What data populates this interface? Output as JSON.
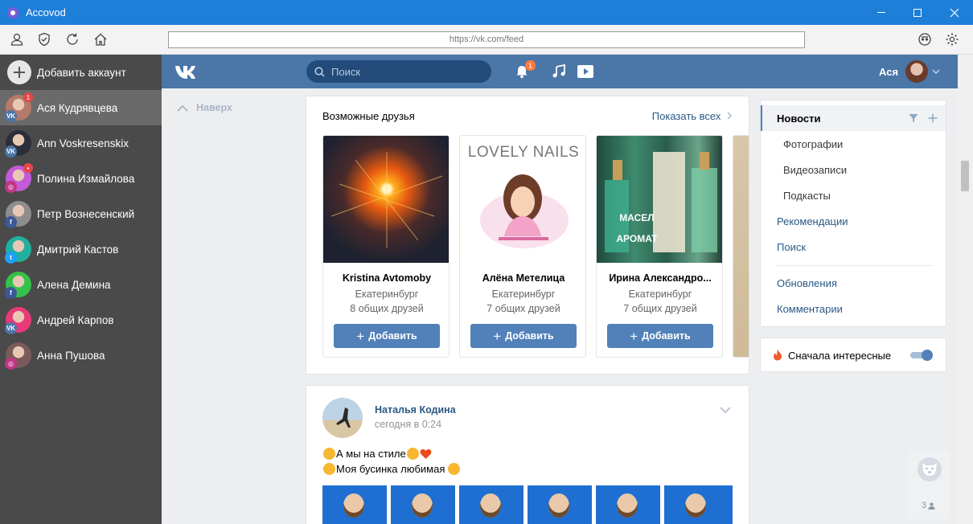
{
  "window": {
    "title": "Accovod"
  },
  "toolbar": {
    "url": "https://vk.com/feed"
  },
  "accounts": {
    "add_label": "Добавить аккаунт",
    "items": [
      {
        "name": "Ася Кудрявцева",
        "network": "vk",
        "badge": "1",
        "active": true,
        "color": "#b57a6a"
      },
      {
        "name": "Ann Voskresenskix",
        "network": "vk",
        "badge": "",
        "active": false,
        "color": "#2c2f3a"
      },
      {
        "name": "Полина Измайлова",
        "network": "instagram",
        "badge": "•",
        "active": false,
        "color": "#c35ad8"
      },
      {
        "name": "Петр Вознесенский",
        "network": "facebook",
        "badge": "",
        "active": false,
        "color": "#8d8d8d"
      },
      {
        "name": "Дмитрий Кастов",
        "network": "twitter",
        "badge": "",
        "active": false,
        "color": "#22b0a0"
      },
      {
        "name": "Алена Демина",
        "network": "facebook",
        "badge": "",
        "active": false,
        "color": "#34c24a"
      },
      {
        "name": "Андрей Карпов",
        "network": "vk",
        "badge": "",
        "active": false,
        "color": "#e83a78"
      },
      {
        "name": "Анна Пушова",
        "network": "instagram",
        "badge": "",
        "active": false,
        "color": "#7a5a5a"
      }
    ]
  },
  "vk_header": {
    "search_placeholder": "Поиск",
    "notification_count": "1",
    "user_name": "Ася"
  },
  "sidebar": {
    "back_to_top": "Наверх"
  },
  "possible_friends": {
    "title": "Возможные друзья",
    "show_all": "Показать всех",
    "add_label": "Добавить",
    "friends": [
      {
        "name": "Kristina Avtomoby",
        "city": "Екатеринбург",
        "mutual": "8 общих друзей"
      },
      {
        "name": "Алёна Метелица",
        "city": "Екатеринбург",
        "mutual": "7 общих друзей",
        "photo_text": "LOVELY NAILS"
      },
      {
        "name": "Ирина Александро...",
        "city": "Екатеринбург",
        "mutual": "7 общих друзей",
        "photo_text": [
          "МАСЕЛ",
          "АРОМАТ"
        ]
      }
    ]
  },
  "post": {
    "author": "Наталья Кодина",
    "time": "сегодня в 0:24",
    "line1": "А мы на стиле",
    "line2": "Моя бусинка любимая"
  },
  "right_nav": {
    "items": [
      {
        "label": "Новости",
        "type": "active"
      },
      {
        "label": "Фотографии",
        "type": "sub"
      },
      {
        "label": "Видеозаписи",
        "type": "sub"
      },
      {
        "label": "Подкасты",
        "type": "sub"
      },
      {
        "label": "Рекомендации",
        "type": "link"
      },
      {
        "label": "Поиск",
        "type": "link"
      },
      {
        "label": "Обновления",
        "type": "link"
      },
      {
        "label": "Комментарии",
        "type": "link"
      }
    ],
    "interesting_first": "Сначала интересные",
    "interesting_first_on": true
  },
  "widget": {
    "count": "3"
  },
  "colors": {
    "vk_blue": "#4a76a8",
    "button": "#5181b8",
    "link": "#2a5885",
    "window_bar": "#1e7fd8"
  }
}
